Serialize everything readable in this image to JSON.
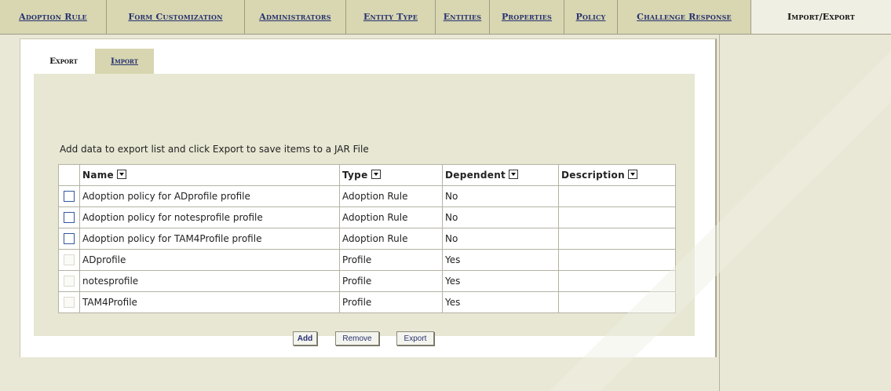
{
  "nav": {
    "tabs": [
      {
        "label": "Adoption Rule"
      },
      {
        "label": "Form Customization"
      },
      {
        "label": "Administrators"
      },
      {
        "label": "Entity Type"
      },
      {
        "label": "Entities"
      },
      {
        "label": "Properties"
      },
      {
        "label": "Policy"
      },
      {
        "label": "Challenge Response"
      },
      {
        "label": "Import/Export",
        "active": true
      }
    ]
  },
  "subtabs": {
    "export_label": "Export",
    "import_label": "Import"
  },
  "export": {
    "instruction": "Add data to export list and click Export to save items to a JAR File",
    "columns": [
      "Name",
      "Type",
      "Dependent",
      "Description"
    ],
    "rows": [
      {
        "name": "Adoption policy for ADprofile profile",
        "type": "Adoption Rule",
        "dependent": "No",
        "description": "",
        "selectable": true
      },
      {
        "name": "Adoption policy for notesprofile profile",
        "type": "Adoption Rule",
        "dependent": "No",
        "description": "",
        "selectable": true
      },
      {
        "name": "Adoption policy for TAM4Profile profile",
        "type": "Adoption Rule",
        "dependent": "No",
        "description": "",
        "selectable": true
      },
      {
        "name": "ADprofile",
        "type": "Profile",
        "dependent": "Yes",
        "description": "",
        "selectable": false
      },
      {
        "name": "notesprofile",
        "type": "Profile",
        "dependent": "Yes",
        "description": "",
        "selectable": false
      },
      {
        "name": "TAM4Profile",
        "type": "Profile",
        "dependent": "Yes",
        "description": "",
        "selectable": false
      }
    ],
    "buttons": {
      "add": "Add",
      "remove": "Remove",
      "export": "Export"
    }
  },
  "colors": {
    "page_bg": "#e9e8d6",
    "tab_bg": "#d8d7b2",
    "link": "#27316f",
    "checkbox_border": "#33589a"
  }
}
